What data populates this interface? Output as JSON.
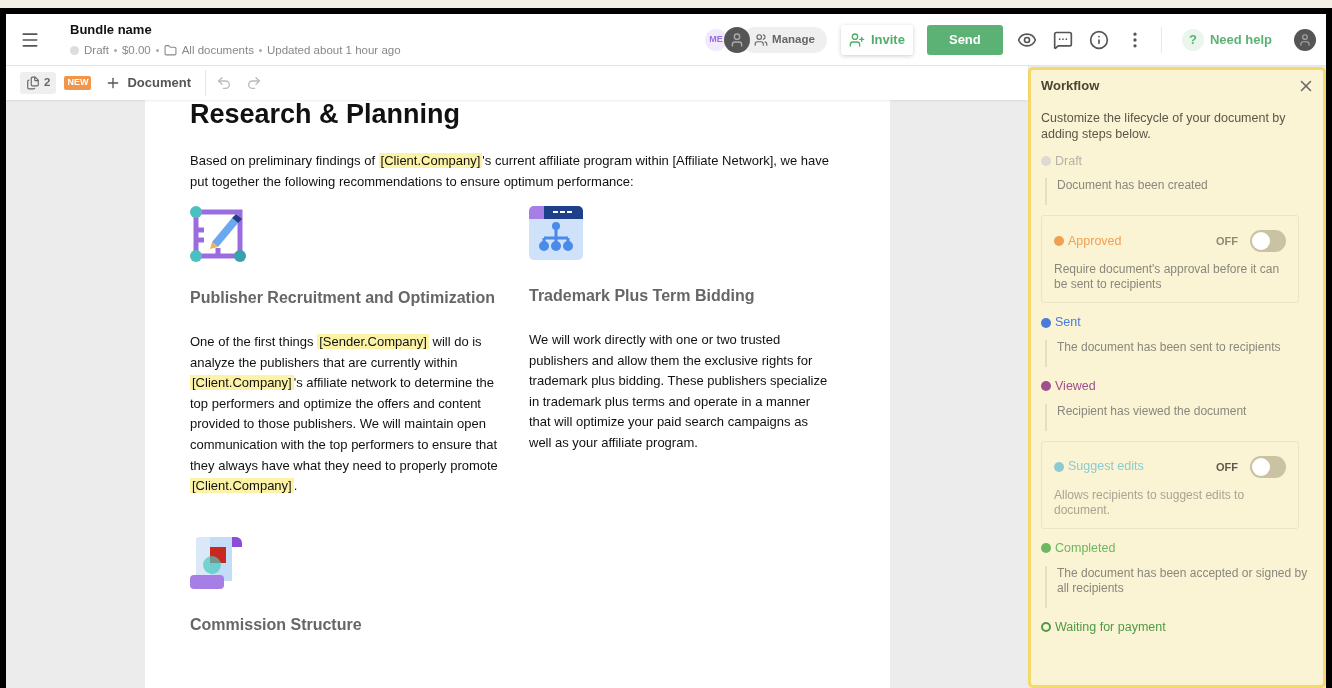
{
  "header": {
    "title": "Bundle name",
    "status": "Draft",
    "price": "$0.00",
    "folder": "All documents",
    "updated": "Updated about 1 hour ago",
    "me_badge": "ME",
    "manage": "Manage",
    "invite": "Invite",
    "send": "Send",
    "help_mark": "?",
    "help": "Need help"
  },
  "toolbar": {
    "page_count": "2",
    "new_badge": "NEW",
    "add_document": "Document"
  },
  "document": {
    "title": "Research & Planning",
    "intro": [
      {
        "kind": "plain",
        "text": "Based on preliminary findings of "
      },
      {
        "kind": "field",
        "text": "[Client.Company]"
      },
      {
        "kind": "plain",
        "text": "'s current affiliate program within [Affiliate Network], we have put together the following recommendations to ensure optimum performance:"
      }
    ],
    "sections": [
      {
        "heading": "Publisher Recruitment and Optimization",
        "body": [
          {
            "kind": "plain",
            "text": "One of the first things "
          },
          {
            "kind": "field",
            "text": "[Sender.Company]"
          },
          {
            "kind": "plain",
            "text": " will do is analyze the publishers that are currently within "
          },
          {
            "kind": "field",
            "text": "[Client.Company]"
          },
          {
            "kind": "plain",
            "text": "'s affiliate network to determine the top performers and optimize the offers and content provided to those publishers. We will maintain open communication with the top performers to ensure that they always have what they need to properly promote "
          },
          {
            "kind": "field",
            "text": "[Client.Company]"
          },
          {
            "kind": "plain",
            "text": "."
          }
        ]
      },
      {
        "heading": "Trademark Plus Term Bidding",
        "body": [
          {
            "kind": "plain",
            "text": "We will work directly with one or two trusted publishers and allow them the exclusive rights for trademark plus bidding. These publishers specialize in trademark plus terms and operate in a manner that will optimize your paid search campaigns as well as your affiliate program."
          }
        ]
      },
      {
        "heading": "Commission Structure"
      }
    ]
  },
  "workflow": {
    "title": "Workflow",
    "intro": "Customize the lifecycle of your document by adding steps below.",
    "steps": [
      {
        "kind": "step",
        "name": "Draft",
        "color": "#dcdad2",
        "hollow": false,
        "description": "Document has been created"
      },
      {
        "kind": "toggle",
        "name": "Approved",
        "color": "#f0a050",
        "hollow": false,
        "state_label": "OFF",
        "on": false,
        "disabled": false,
        "description": "Require document's approval before it can be sent to recipients"
      },
      {
        "kind": "step",
        "name": "Sent",
        "color": "#4a7bd8",
        "hollow": false,
        "description": "The document has been sent to recipients"
      },
      {
        "kind": "step",
        "name": "Viewed",
        "color": "#a0508c",
        "hollow": false,
        "description": "Recipient has viewed the document"
      },
      {
        "kind": "toggle",
        "name": "Suggest edits",
        "color": "#8ccbd0",
        "hollow": false,
        "state_label": "OFF",
        "on": false,
        "disabled": true,
        "description": "Allows recipients to suggest edits to document."
      },
      {
        "kind": "step",
        "name": "Completed",
        "color": "#6cb860",
        "hollow": false,
        "description": "The document has been accepted or signed by all recipients"
      },
      {
        "kind": "step",
        "name": "Waiting for payment",
        "color": "#4f9a48",
        "hollow": true
      }
    ]
  }
}
